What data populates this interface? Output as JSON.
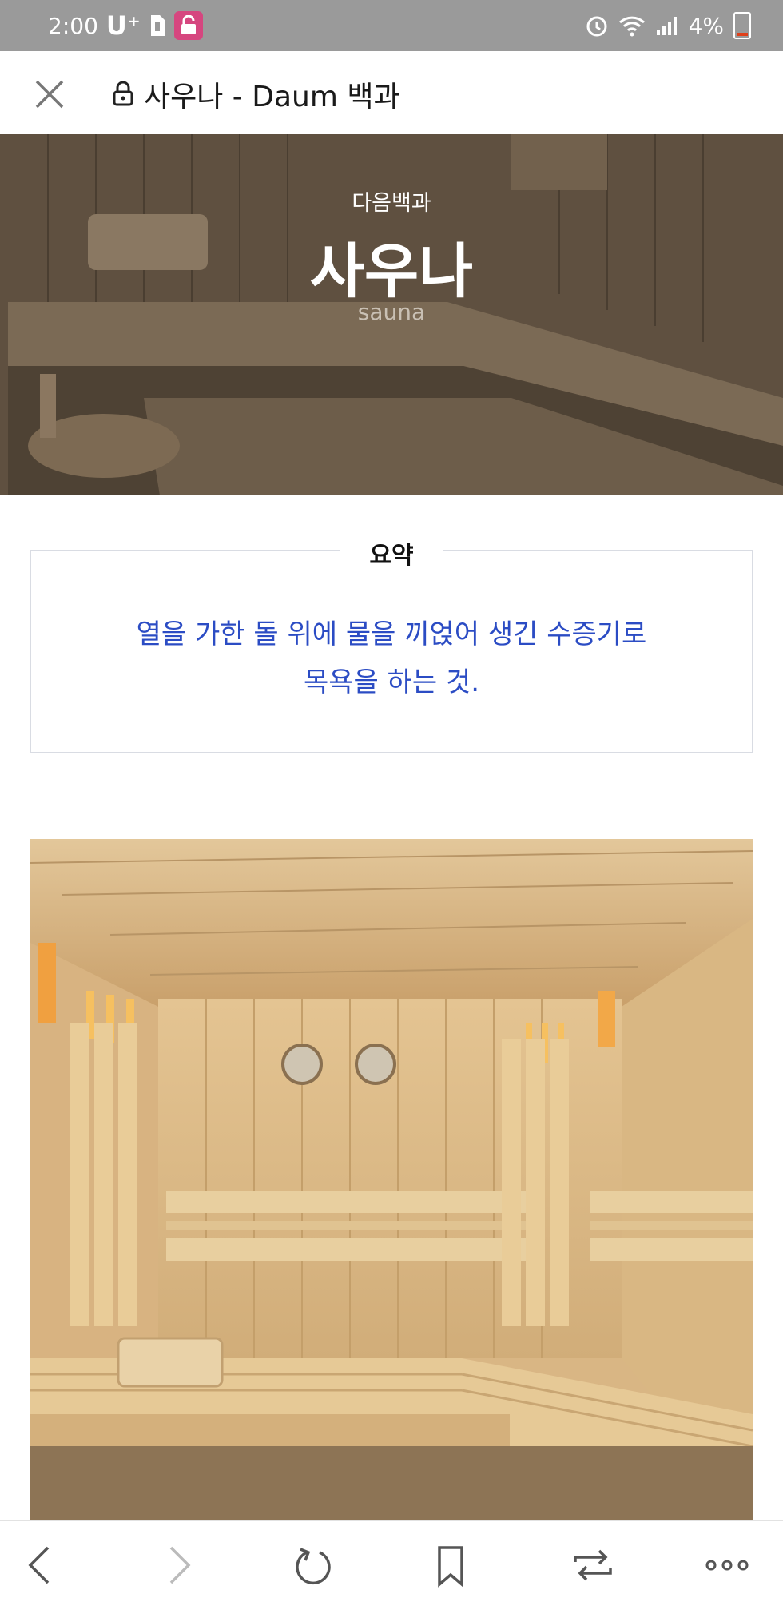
{
  "status_bar": {
    "time": "2:00",
    "carrier": "U⁺",
    "battery": "4%"
  },
  "url_bar": {
    "title": "사우나 - Daum 백과"
  },
  "hero": {
    "kicker": "다음백과",
    "title": "사우나",
    "subtitle": "sauna"
  },
  "summary": {
    "label": "요약",
    "line1": "열을 가한 돌 위에 물을 끼얹어 생긴 수증기로",
    "line2": "목욕을 하는 것."
  },
  "colors": {
    "summary_text": "#2b4cc4",
    "status_bar": "#9a9a9a",
    "lock_badge": "#d6467f"
  },
  "toolbar": {
    "icons": [
      "back-icon",
      "forward-icon",
      "refresh-icon",
      "bookmark-icon",
      "tabs-icon",
      "more-icon"
    ]
  }
}
